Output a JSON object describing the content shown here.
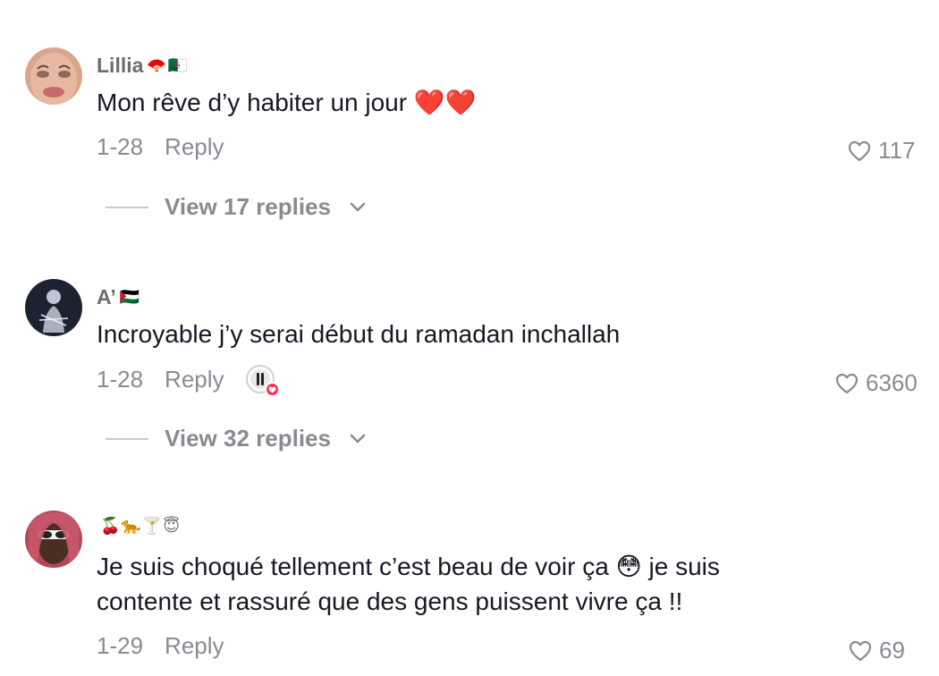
{
  "comments": [
    {
      "username": "Lillia",
      "username_emoji": "🪭🇩🇿",
      "text": "Mon rêve d’y habiter un jour ❤️❤️",
      "date": "1-28",
      "reply_label": "Reply",
      "likes": "117",
      "view_replies": "View 17 replies"
    },
    {
      "username": "A’",
      "username_emoji": "🇵🇸",
      "text": "Incroyable j’y serai début du ramadan inchallah",
      "date": "1-28",
      "reply_label": "Reply",
      "likes": "6360",
      "view_replies": "View 32 replies"
    },
    {
      "username": "",
      "username_emoji": "🍒🐆🍸😇",
      "text": "Je suis choqué tellement c’est beau de voir ça 😳 je suis contente et rassuré que des gens puissent vivre ça !!",
      "date": "1-29",
      "reply_label": "Reply",
      "likes": "69"
    }
  ],
  "icons": {
    "like": "heart-outline-icon",
    "expand": "chevron-down-icon",
    "creator_liked": "creator-liked-badge-icon"
  },
  "colors": {
    "text": "#161823",
    "muted": "#8a8b91",
    "accent": "#fe2c55"
  }
}
